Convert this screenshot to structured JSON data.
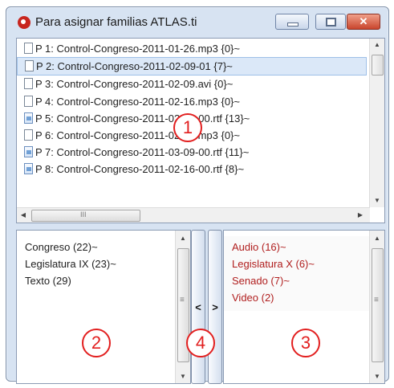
{
  "window": {
    "title": "Para asignar familias ATLAS.ti",
    "minimize_icon": "minimize-icon",
    "maximize_icon": "maximize-icon",
    "close_glyph": "✕"
  },
  "documents": {
    "items": [
      {
        "label": "P 1: Control-Congreso-2011-01-26.mp3 {0}~",
        "icon": "document-icon",
        "selected": false
      },
      {
        "label": "P 2: Control-Congreso-2011-02-09-01 {7}~",
        "icon": "document-icon",
        "selected": true
      },
      {
        "label": "P 3: Control-Congreso-2011-02-09.avi {0}~",
        "icon": "document-icon",
        "selected": false
      },
      {
        "label": "P 4: Control-Congreso-2011-02-16.mp3 {0}~",
        "icon": "document-icon",
        "selected": false
      },
      {
        "label": "P 5: Control-Congreso-2011-02-23-00.rtf {13}~",
        "icon": "rtf-document-icon",
        "selected": false
      },
      {
        "label": "P 6: Control-Congreso-2011-02-23.mp3 {0}~",
        "icon": "document-icon",
        "selected": false
      },
      {
        "label": "P 7: Control-Congreso-2011-03-09-00.rtf {11}~",
        "icon": "rtf-document-icon",
        "selected": false
      },
      {
        "label": "P 8: Control-Congreso-2011-02-16-00.rtf {8}~",
        "icon": "rtf-document-icon",
        "selected": false
      }
    ],
    "scroll_up": "▲",
    "scroll_down": "▼",
    "scroll_left": "◀",
    "scroll_right": "▶",
    "grip": "III"
  },
  "not_member_families": {
    "items": [
      "Congreso (22)~",
      "Legislatura IX (23)~",
      "Texto (29)"
    ],
    "scroll_up": "▲",
    "scroll_down": "▼",
    "grip": "≡"
  },
  "member_families": {
    "items": [
      "Audio (16)~",
      "Legislatura X (6)~",
      "Senado (7)~",
      "Video (2)"
    ],
    "scroll_up": "▲",
    "scroll_down": "▼",
    "grip": "≡",
    "text_color": "#b01e1e"
  },
  "move_buttons": {
    "remove": "<",
    "add": ">"
  },
  "callouts": [
    "1",
    "2",
    "3",
    "4"
  ],
  "colors": {
    "callout": "#e21f1f",
    "selection": "#dbe8f8",
    "frame": "#d7e3f2"
  }
}
